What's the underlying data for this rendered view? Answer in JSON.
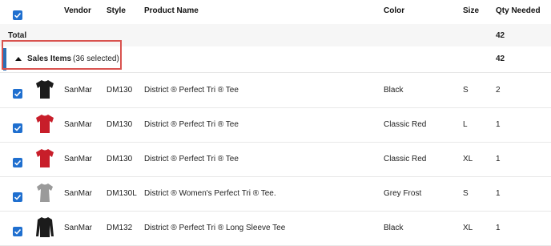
{
  "header": {
    "vendor": "Vendor",
    "style": "Style",
    "product_name": "Product Name",
    "color": "Color",
    "size": "Size",
    "qty_needed": "Qty Needed"
  },
  "total": {
    "label": "Total",
    "qty": "42"
  },
  "group": {
    "title": "Sales Items",
    "count": "(36 selected)",
    "qty": "42"
  },
  "items": [
    {
      "vendor": "SanMar",
      "style": "DM130",
      "product": "District ® Perfect Tri ® Tee",
      "color": "Black",
      "size": "S",
      "qty": "2",
      "shirt_color": "#1b1b1b",
      "shirt_icon": "tee-icon"
    },
    {
      "vendor": "SanMar",
      "style": "DM130",
      "product": "District ® Perfect Tri ® Tee",
      "color": "Classic Red",
      "size": "L",
      "qty": "1",
      "shirt_color": "#c81e2a",
      "shirt_icon": "tee-icon"
    },
    {
      "vendor": "SanMar",
      "style": "DM130",
      "product": "District ® Perfect Tri ® Tee",
      "color": "Classic Red",
      "size": "XL",
      "qty": "1",
      "shirt_color": "#c81e2a",
      "shirt_icon": "tee-icon"
    },
    {
      "vendor": "SanMar",
      "style": "DM130L",
      "product": "District ® Women's Perfect Tri ® Tee.",
      "color": "Grey Frost",
      "size": "S",
      "qty": "1",
      "shirt_color": "#9a9a9a",
      "shirt_icon": "women-tee-icon"
    },
    {
      "vendor": "SanMar",
      "style": "DM132",
      "product": "District ® Perfect Tri ® Long Sleeve Tee",
      "color": "Black",
      "size": "XL",
      "qty": "1",
      "shirt_color": "#1b1b1b",
      "shirt_icon": "long-sleeve-tee-icon"
    }
  ],
  "colors": {
    "accent": "#1f6fcf",
    "group_bar": "#2a6fb6",
    "highlight_border": "#d9534f",
    "total_bg": "#f6f6f6"
  }
}
